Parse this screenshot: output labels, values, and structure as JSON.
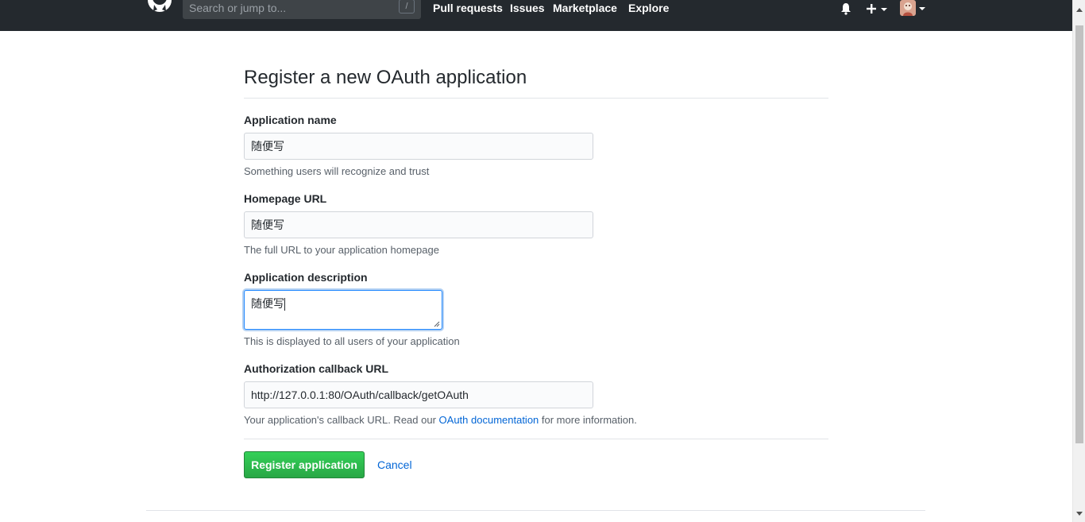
{
  "header": {
    "search": {
      "placeholder": "Search or jump to...",
      "shortcut": "/"
    },
    "nav": [
      {
        "label": "Pull requests"
      },
      {
        "label": "Issues"
      },
      {
        "label": "Marketplace"
      },
      {
        "label": "Explore"
      }
    ],
    "icons": {
      "logo": "github-octocat-icon",
      "notifications": "bell-icon",
      "create": "plus-icon",
      "avatar": "user-avatar"
    }
  },
  "page": {
    "title": "Register a new OAuth application"
  },
  "form": {
    "app_name": {
      "label": "Application name",
      "value": "随便写",
      "note": "Something users will recognize and trust"
    },
    "homepage": {
      "label": "Homepage URL",
      "value": "随便写",
      "note": "The full URL to your application homepage"
    },
    "description": {
      "label": "Application description",
      "value": "随便写",
      "note": "This is displayed to all users of your application"
    },
    "callback": {
      "label": "Authorization callback URL",
      "value": "http://127.0.0.1:80/OAuth/callback/getOAuth",
      "note_before": "Your application's callback URL. Read our ",
      "note_link": "OAuth documentation",
      "note_after": " for more information."
    }
  },
  "actions": {
    "submit_label": "Register application",
    "cancel_label": "Cancel"
  },
  "colors": {
    "header_bg": "#24292e",
    "primary_green": "#28a745",
    "link_blue": "#0366d6",
    "focus_blue": "#2188ff"
  }
}
